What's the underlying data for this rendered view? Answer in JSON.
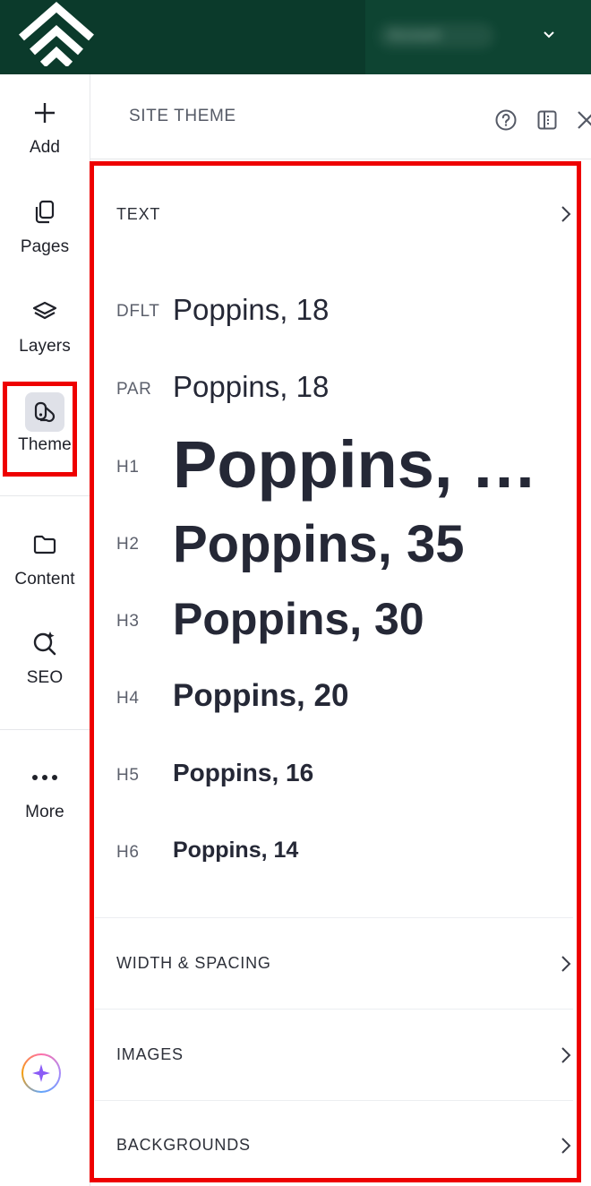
{
  "topbar": {
    "account_name": "Account",
    "colors": {
      "background": "#0b3a2b",
      "account_bg": "#0e4432"
    }
  },
  "sidebar": {
    "items": [
      {
        "label": "Add",
        "icon": "plus-icon"
      },
      {
        "label": "Pages",
        "icon": "pages-icon"
      },
      {
        "label": "Layers",
        "icon": "layers-icon"
      },
      {
        "label": "Theme",
        "icon": "theme-icon",
        "active": true
      },
      {
        "label": "Content",
        "icon": "folder-icon"
      },
      {
        "label": "SEO",
        "icon": "seo-icon"
      },
      {
        "label": "More",
        "icon": "more-icon"
      }
    ],
    "ai_button_icon": "sparkle-icon"
  },
  "panel": {
    "title": "SITE THEME",
    "header_icons": [
      "help-icon",
      "dock-icon",
      "close-icon"
    ],
    "text_section_label": "TEXT",
    "type_styles": [
      {
        "tag": "DFLT",
        "sample": "Poppins, 18"
      },
      {
        "tag": "PAR",
        "sample": "Poppins, 18"
      },
      {
        "tag": "H1",
        "sample": "Poppins, …"
      },
      {
        "tag": "H2",
        "sample": "Poppins, 35"
      },
      {
        "tag": "H3",
        "sample": "Poppins, 30"
      },
      {
        "tag": "H4",
        "sample": "Poppins, 20"
      },
      {
        "tag": "H5",
        "sample": "Poppins, 16"
      },
      {
        "tag": "H6",
        "sample": "Poppins, 14"
      }
    ],
    "sections": [
      {
        "label": "WIDTH & SPACING"
      },
      {
        "label": "IMAGES"
      },
      {
        "label": "BACKGROUNDS"
      }
    ]
  },
  "colors": {
    "highlight": "#ee0000",
    "text": "#252836"
  }
}
